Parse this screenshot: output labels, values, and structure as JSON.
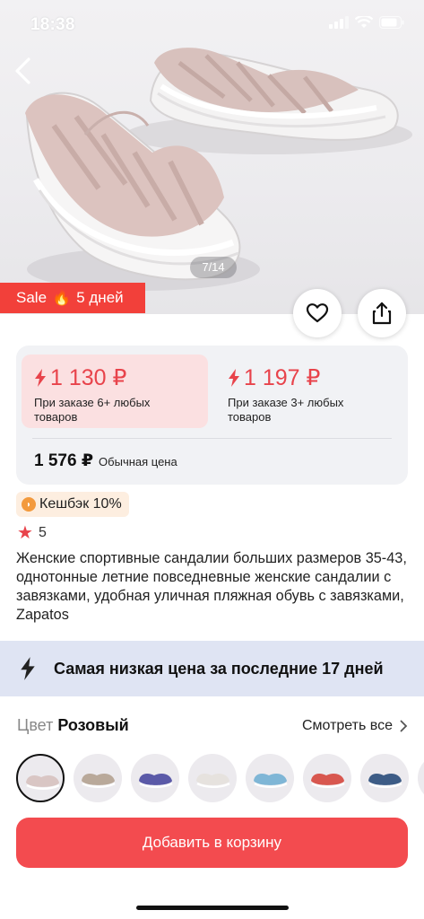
{
  "status": {
    "time": "18:38"
  },
  "gallery": {
    "counter": "7/14"
  },
  "sale": {
    "label": "Sale",
    "days": "5 дней"
  },
  "icons": {
    "favorite": "heart-icon",
    "share": "share-icon",
    "back": "chevron-left-icon",
    "bolt": "lightning-icon",
    "star": "star-icon",
    "chevron": "chevron-right-icon"
  },
  "prices": {
    "offers": [
      {
        "value": "1 130 ₽",
        "note": "При заказе 6+ любых товаров"
      },
      {
        "value": "1 197 ₽",
        "note": "При заказе 3+ любых товаров"
      }
    ],
    "regular_value": "1 576 ₽",
    "regular_label": "Обычная цена"
  },
  "cashback": {
    "label": "Кешбэк 10%"
  },
  "rating": {
    "value": "5"
  },
  "product": {
    "title": "Женские спортивные сандалии больших размеров 35-43, однотонные летние повседневные женские сандалии с завязками, удобная уличная пляжная обувь с завязками, Zapatos"
  },
  "lowest_price": {
    "text": "Самая низкая цена за последние 17 дней"
  },
  "color": {
    "label": "Цвет",
    "value": "Розовый",
    "see_all": "Смотреть все"
  },
  "swatch_colors": [
    "#d9c6c4",
    "#b9a99a",
    "#5b5aa8",
    "#e6e2de",
    "#7fb6d6",
    "#d8574f",
    "#3d5c86",
    "#6b7a8c"
  ],
  "cart": {
    "label": "Добавить в корзину"
  },
  "colors": {
    "accent": "#f34b4f",
    "price_red": "#e8434b",
    "banner_bg": "#dfe4f3"
  }
}
